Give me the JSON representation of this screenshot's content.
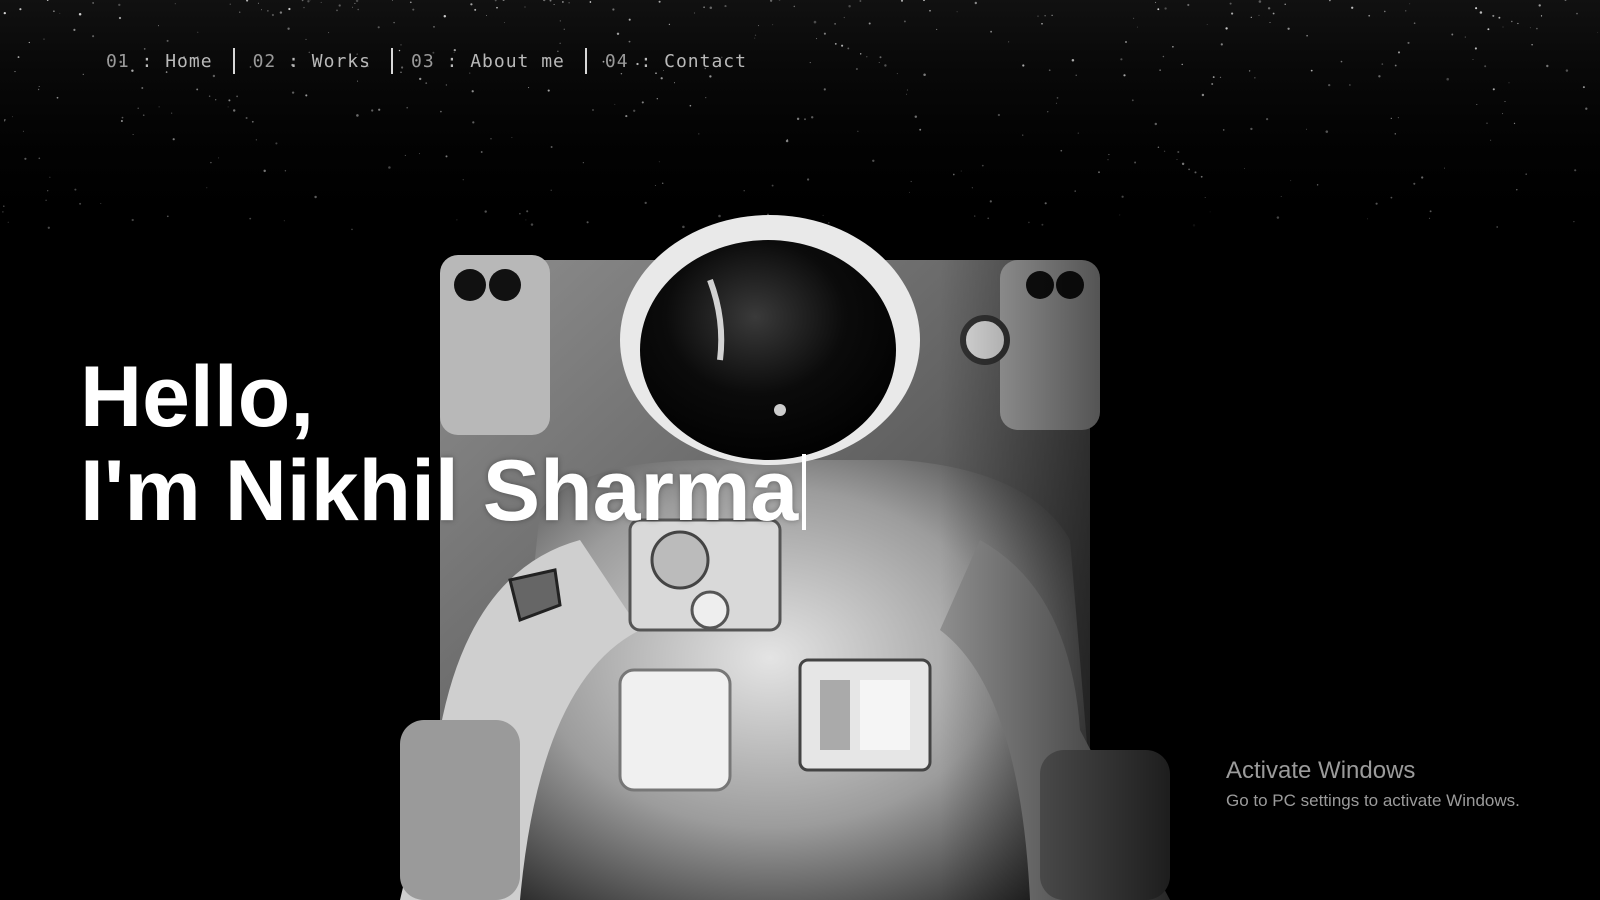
{
  "nav": {
    "items": [
      {
        "number": "01",
        "label": "Home"
      },
      {
        "number": "02",
        "label": "Works"
      },
      {
        "number": "03",
        "label": "About me"
      },
      {
        "number": "04",
        "label": "Contact"
      }
    ],
    "separator": ":"
  },
  "hero": {
    "line1": "Hello,",
    "line2": "I'm Nikhil Sharma"
  },
  "watermark": {
    "title": "Activate Windows",
    "subtitle": "Go to PC settings to activate Windows."
  },
  "colors": {
    "background": "#000000",
    "text": "#ffffff",
    "nav_text": "#b9b9b9"
  }
}
